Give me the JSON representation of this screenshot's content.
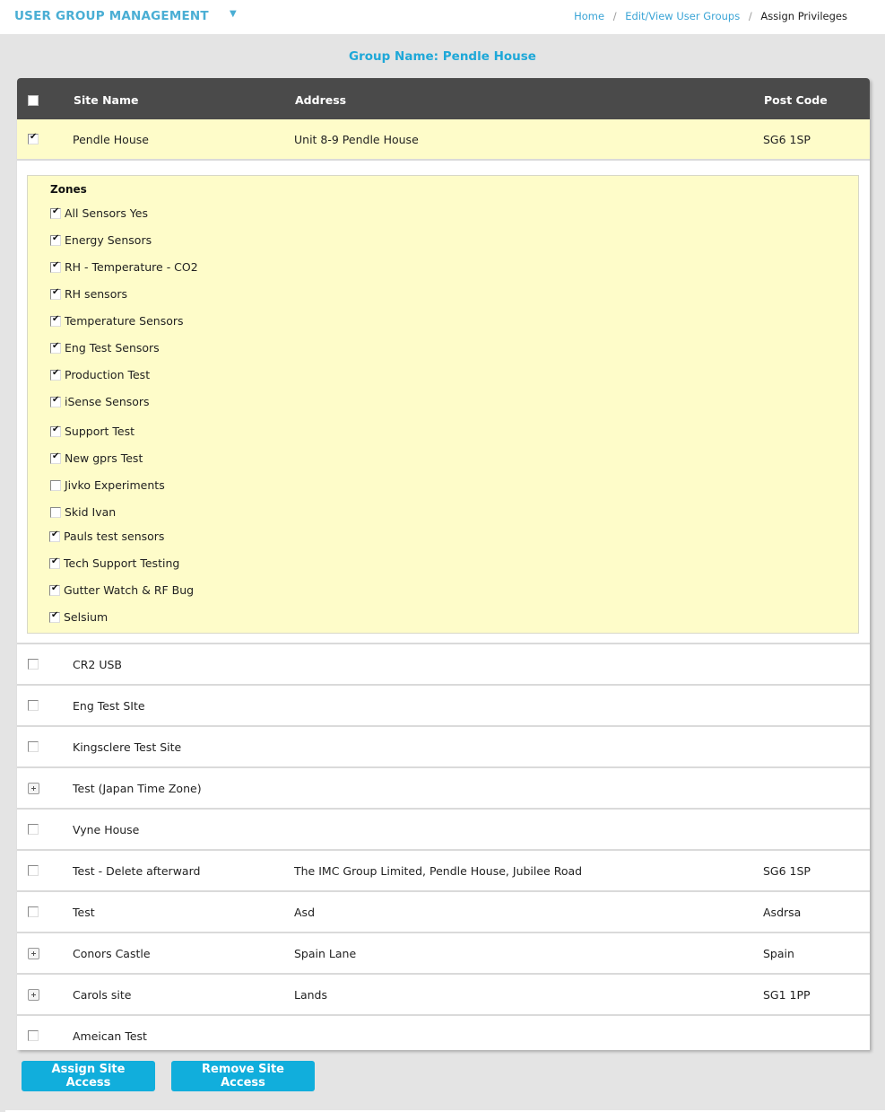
{
  "header": {
    "app_title": "USER GROUP MANAGEMENT",
    "menu_caret": "▼",
    "breadcrumb": [
      {
        "label": "Home"
      },
      {
        "label": "Edit/View User Groups"
      },
      {
        "label": "Assign Privileges"
      }
    ],
    "breadcrumb_separator": "/"
  },
  "group_name": "Group Name: Pendle House",
  "table": {
    "columns": {
      "site_name": "Site Name",
      "address": "Address",
      "post_code": "Post Code"
    },
    "select_all_checked": false,
    "rows": [
      {
        "site_name": "Pendle House",
        "address": "Unit 8-9 Pendle House",
        "post_code": "SG6 1SP",
        "control": "checkbox",
        "checked": true,
        "selected": true
      }
    ],
    "zones": {
      "title": "Zones",
      "items": [
        {
          "label": "All Sensors Yes",
          "checked": true
        },
        {
          "label": "Energy Sensors",
          "checked": true
        },
        {
          "label": "RH - Temperature - CO2",
          "checked": true
        },
        {
          "label": "RH sensors",
          "checked": true
        },
        {
          "label": "Temperature Sensors",
          "checked": true
        },
        {
          "label": "Eng Test Sensors",
          "checked": true
        },
        {
          "label": "Production Test",
          "checked": true
        },
        {
          "label": "iSense Sensors",
          "checked": true
        },
        {
          "label": "Support Test",
          "checked": true
        },
        {
          "label": "New gprs Test",
          "checked": true
        },
        {
          "label": "Jivko Experiments",
          "checked": false
        },
        {
          "label": "Skid Ivan",
          "checked": false
        },
        {
          "label": "Pauls test sensors",
          "checked": true
        },
        {
          "label": "Tech Support Testing",
          "checked": true
        },
        {
          "label": "Gutter Watch & RF Bug",
          "checked": true
        },
        {
          "label": "Selsium",
          "checked": true
        }
      ]
    },
    "other_rows": [
      {
        "site_name": "CR2 USB",
        "address": "",
        "post_code": "",
        "control": "checkbox",
        "checked": false
      },
      {
        "site_name": "Eng Test SIte",
        "address": "",
        "post_code": "",
        "control": "checkbox",
        "checked": false
      },
      {
        "site_name": "Kingsclere Test Site",
        "address": "",
        "post_code": "",
        "control": "checkbox",
        "checked": false
      },
      {
        "site_name": "Test (Japan Time Zone)",
        "address": "",
        "post_code": "",
        "control": "expand",
        "checked": false
      },
      {
        "site_name": "Vyne House",
        "address": "",
        "post_code": "",
        "control": "checkbox",
        "checked": false
      },
      {
        "site_name": "Test - Delete afterward",
        "address": "The IMC Group Limited, Pendle House, Jubilee Road",
        "post_code": "SG6 1SP",
        "control": "checkbox",
        "checked": false
      },
      {
        "site_name": "Test",
        "address": "Asd",
        "post_code": "Asdrsa",
        "control": "checkbox",
        "checked": false
      },
      {
        "site_name": "Conors Castle",
        "address": "Spain Lane",
        "post_code": "Spain",
        "control": "expand",
        "checked": false
      },
      {
        "site_name": "Carols site",
        "address": "Lands",
        "post_code": "SG1 1PP",
        "control": "expand",
        "checked": false
      },
      {
        "site_name": "Ameican Test",
        "address": "",
        "post_code": "",
        "control": "checkbox",
        "checked": false
      }
    ]
  },
  "actions": {
    "assign_label": "Assign Site Access",
    "remove_label": "Remove Site Access"
  },
  "colors": {
    "accent": "#11aedc",
    "title_blue": "#4aaed4",
    "header_bg": "#4a4a4a",
    "selected_bg": "#fefcc9",
    "page_bg": "#e4e4e4"
  }
}
